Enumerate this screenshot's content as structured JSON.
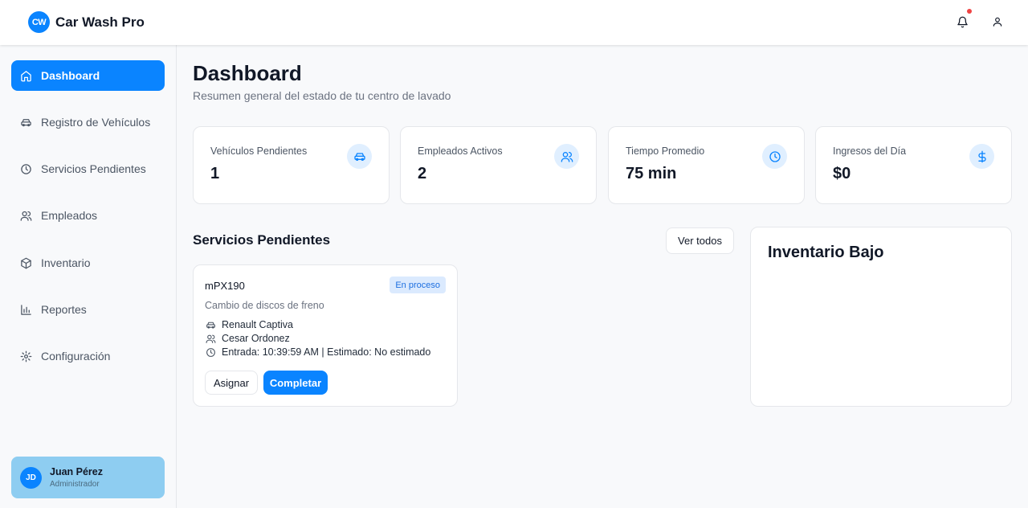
{
  "app": {
    "logo_initials": "CW",
    "name": "Car Wash Pro"
  },
  "header": {
    "icons": [
      "bell-icon",
      "user-icon"
    ],
    "has_notification": true
  },
  "sidebar": {
    "items": [
      {
        "label": "Dashboard",
        "icon": "home-icon",
        "active": true
      },
      {
        "label": "Registro de Vehículos",
        "icon": "car-icon",
        "active": false
      },
      {
        "label": "Servicios Pendientes",
        "icon": "clock-icon",
        "active": false
      },
      {
        "label": "Empleados",
        "icon": "users-icon",
        "active": false
      },
      {
        "label": "Inventario",
        "icon": "box-icon",
        "active": false
      },
      {
        "label": "Reportes",
        "icon": "bar-chart-icon",
        "active": false
      },
      {
        "label": "Configuración",
        "icon": "gear-icon",
        "active": false
      }
    ],
    "user": {
      "initials": "JD",
      "name": "Juan Pérez",
      "role": "Administrador"
    }
  },
  "main": {
    "title": "Dashboard",
    "subtitle": "Resumen general del estado de tu centro de lavado",
    "stats": [
      {
        "label": "Vehículos Pendientes",
        "value": "1",
        "icon": "car-icon"
      },
      {
        "label": "Empleados Activos",
        "value": "2",
        "icon": "users-icon"
      },
      {
        "label": "Tiempo Promedio",
        "value": "75 min",
        "icon": "clock-icon"
      },
      {
        "label": "Ingresos del Día",
        "value": "$0",
        "icon": "dollar-icon"
      }
    ],
    "pending": {
      "title": "Servicios Pendientes",
      "view_all_label": "Ver todos",
      "services": [
        {
          "plate": "mPX190",
          "status": "En proceso",
          "service": "Cambio de discos de freno",
          "vehicle": "Renault Captiva",
          "employee": "Cesar Ordonez",
          "times": "Entrada: 10:39:59 AM | Estimado: No estimado",
          "assign_label": "Asignar",
          "complete_label": "Completar"
        }
      ]
    },
    "inventory": {
      "title": "Inventario Bajo"
    }
  },
  "colors": {
    "accent": "#0a84ff",
    "badge_bg": "#dbeafe",
    "badge_text": "#1d6fe0",
    "user_card": "#8ecdf1",
    "notification": "#ef4444"
  }
}
